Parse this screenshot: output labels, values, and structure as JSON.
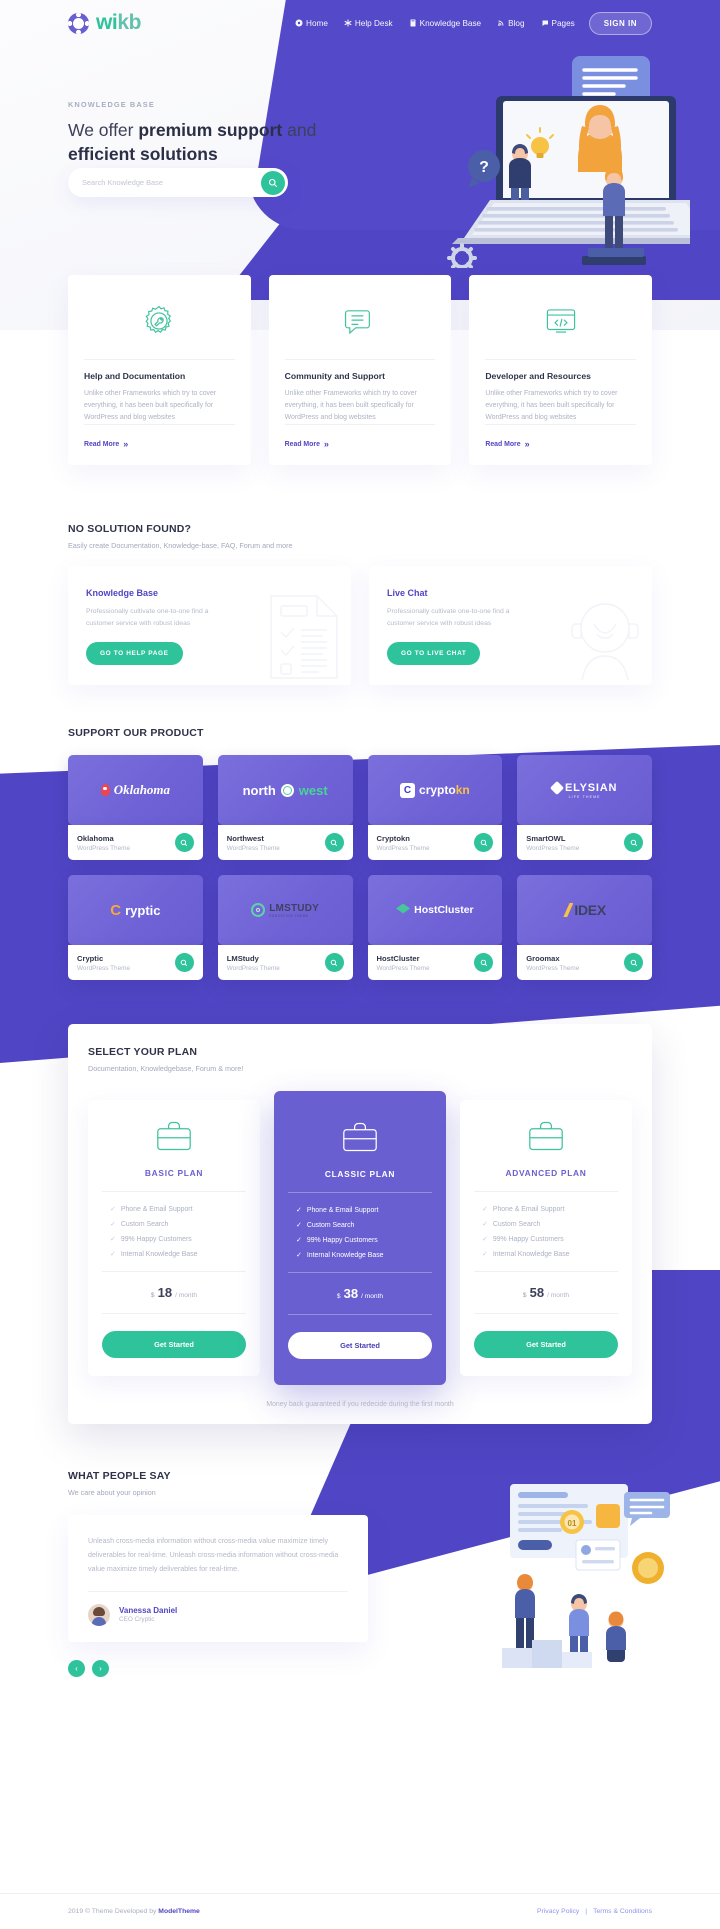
{
  "brand": {
    "name_a": "wi",
    "name_b": "kb",
    "logo_icon": "lifebuoy-icon"
  },
  "nav": {
    "items": [
      {
        "label": "Home",
        "icon": "home-icon"
      },
      {
        "label": "Help Desk",
        "icon": "asterisk-icon"
      },
      {
        "label": "Knowledge Base",
        "icon": "book-icon"
      },
      {
        "label": "Blog",
        "icon": "rss-icon"
      },
      {
        "label": "Pages",
        "icon": "comment-icon"
      }
    ],
    "signin_label": "SIGN IN"
  },
  "hero": {
    "eyebrow": "KNOWLEDGE BASE",
    "title_line1_pre": "We offer ",
    "title_line1_bold": "premium support",
    "title_line1_post": " and",
    "title_line2": "efficient solutions",
    "search_placeholder": "Search Knowledge Base",
    "search_value": "",
    "search_icon": "search-icon"
  },
  "features": [
    {
      "icon": "gear-wrench-icon",
      "title": "Help and Documentation",
      "text": "Unlike other Frameworks which try to cover everything, it has been built specifically for WordPress and blog websites",
      "link": "Read More"
    },
    {
      "icon": "chat-lines-icon",
      "title": "Community and Support",
      "text": "Unlike other Frameworks which try to cover everything, it has been built specifically for WordPress and blog websites",
      "link": "Read More"
    },
    {
      "icon": "code-window-icon",
      "title": "Developer and Resources",
      "text": "Unlike other Frameworks which try to cover everything, it has been built specifically for WordPress and blog websites",
      "link": "Read More"
    }
  ],
  "nosolution": {
    "heading": "NO SOLUTION FOUND?",
    "sub": "Easily create Documentation, Knowledge-base, FAQ, Forum and more",
    "cards": [
      {
        "title": "Knowledge Base",
        "text": "Professionally cultivate one-to-one find a customer service with robust ideas",
        "button": "GO TO HELP PAGE",
        "art": "checklist-document-icon"
      },
      {
        "title": "Live Chat",
        "text": "Professionally cultivate one-to-one find a customer service with robust ideas",
        "button": "GO TO LIVE CHAT",
        "art": "support-agent-icon"
      }
    ]
  },
  "products": {
    "heading": "SUPPORT OUR PRODUCT",
    "items": [
      {
        "name": "Oklahoma",
        "sub": "WordPress Theme",
        "logo": "oklahoma-logo"
      },
      {
        "name": "Northwest",
        "sub": "WordPress Theme",
        "logo": "northwest-logo"
      },
      {
        "name": "Cryptokn",
        "sub": "WordPress Theme",
        "logo": "cryptokn-logo"
      },
      {
        "name": "SmartOWL",
        "sub": "WordPress Theme",
        "logo": "elysian-logo"
      },
      {
        "name": "Cryptic",
        "sub": "WordPress Theme",
        "logo": "cryptic-logo"
      },
      {
        "name": "LMStudy",
        "sub": "WordPress Theme",
        "logo": "lmstudy-logo"
      },
      {
        "name": "HostCluster",
        "sub": "WordPress Theme",
        "logo": "hostcluster-logo"
      },
      {
        "name": "Groomax",
        "sub": "WordPress Theme",
        "logo": "idex-logo"
      }
    ],
    "logo_text": {
      "oklahoma": "Oklahoma",
      "north": "north",
      "west": "west",
      "crypto": "crypto",
      "kn": "kn",
      "ck_mark": "C",
      "elysian": "ELYSIAN",
      "elysian_sub": "LIFE THEME",
      "cryptic_c": "C",
      "cryptic_rest": "ryptic",
      "lmstudy": "LMSTUDY",
      "lmstudy_sub": "EDUCATION THEME",
      "hostcluster": "HostCluster",
      "idex": "IDEX"
    },
    "zoom_icon": "magnifier-icon"
  },
  "pricing": {
    "heading": "SELECT YOUR PLAN",
    "sub": "Documentation, Knowledgebase, Forum & more!",
    "currency": "$",
    "period": "/ month",
    "guarantee": "Money back guaranteed if you redecide during the first month",
    "plans": [
      {
        "name": "BASIC PLAN",
        "price": "18",
        "featured": false,
        "icon": "briefcase-icon",
        "button": "Get Started",
        "features": [
          "Phone & Email Support",
          "Custom Search",
          "99% Happy Customers",
          "Internal Knowledge Base"
        ]
      },
      {
        "name": "CLASSIC PLAN",
        "price": "38",
        "featured": true,
        "icon": "briefcase-icon",
        "button": "Get Started",
        "features": [
          "Phone & Email Support",
          "Custom Search",
          "99% Happy Customers",
          "Internal Knowledge Base"
        ]
      },
      {
        "name": "ADVANCED PLAN",
        "price": "58",
        "featured": false,
        "icon": "briefcase-icon",
        "button": "Get Started",
        "features": [
          "Phone & Email Support",
          "Custom Search",
          "99% Happy Customers",
          "Internal Knowledge Base"
        ]
      }
    ]
  },
  "testimonial": {
    "heading": "WHAT PEOPLE SAY",
    "sub": "We care about your opinion",
    "quote": "Unleash cross-media information without cross-media value maximize timely deliverables for real-time. Unleash cross-media information without cross-media value maximize timely deliverables for real-time.",
    "author": "Vanessa Daniel",
    "role": "CEO Cryptic",
    "avatar": "avatar",
    "prev_icon": "chevron-left-icon",
    "next_icon": "chevron-right-icon"
  },
  "footer": {
    "copy_pre": "2019 © Theme Developed by ",
    "copy_brand": "ModelTheme",
    "links": [
      "Privacy Policy",
      "Terms & Conditions"
    ],
    "separator": "|"
  },
  "colors": {
    "purple": "#5045c4",
    "purple_light": "#6a5fd0",
    "green": "#2fc39b",
    "text": "#3d4260"
  }
}
